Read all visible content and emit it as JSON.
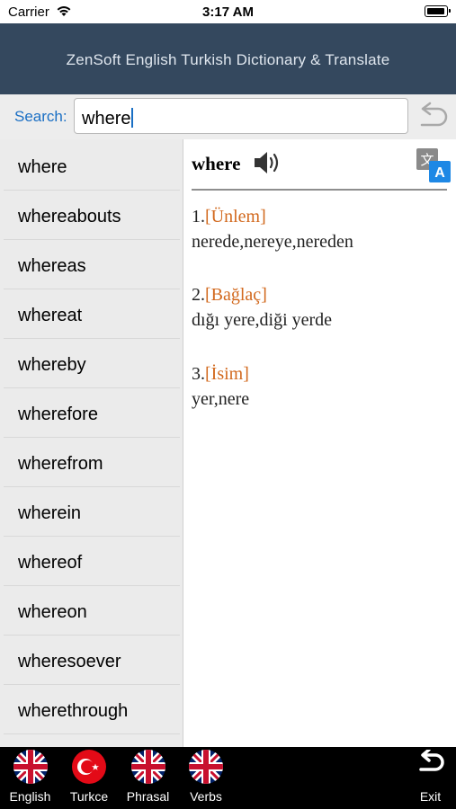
{
  "status": {
    "carrier": "Carrier",
    "time": "3:17 AM"
  },
  "header": {
    "title": "ZenSoft English Turkish Dictionary & Translate"
  },
  "search": {
    "label": "Search:",
    "value": "where"
  },
  "words": [
    "where",
    "whereabouts",
    "whereas",
    "whereat",
    "whereby",
    "wherefore",
    "wherefrom",
    "wherein",
    "whereof",
    "whereon",
    "wheresoever",
    "wherethrough"
  ],
  "detail": {
    "word": "where",
    "senses": [
      {
        "num": "1.",
        "pos": "[Ünlem]",
        "meaning": "nerede,nereye,nereden"
      },
      {
        "num": "2.",
        "pos": "[Bağlaç]",
        "meaning": "dığı yere,diği yerde"
      },
      {
        "num": "3.",
        "pos": "[İsim]",
        "meaning": "yer,nere"
      }
    ]
  },
  "tabs": {
    "english": "English",
    "turkce": "Turkce",
    "phrasal": "Phrasal",
    "verbs": "Verbs",
    "exit": "Exit"
  },
  "colors": {
    "header_bg": "#34485e",
    "accent_blue": "#1a6fc4",
    "pos_orange": "#d2691e",
    "list_bg": "#ebebeb",
    "tabbar_bg": "#000000"
  }
}
